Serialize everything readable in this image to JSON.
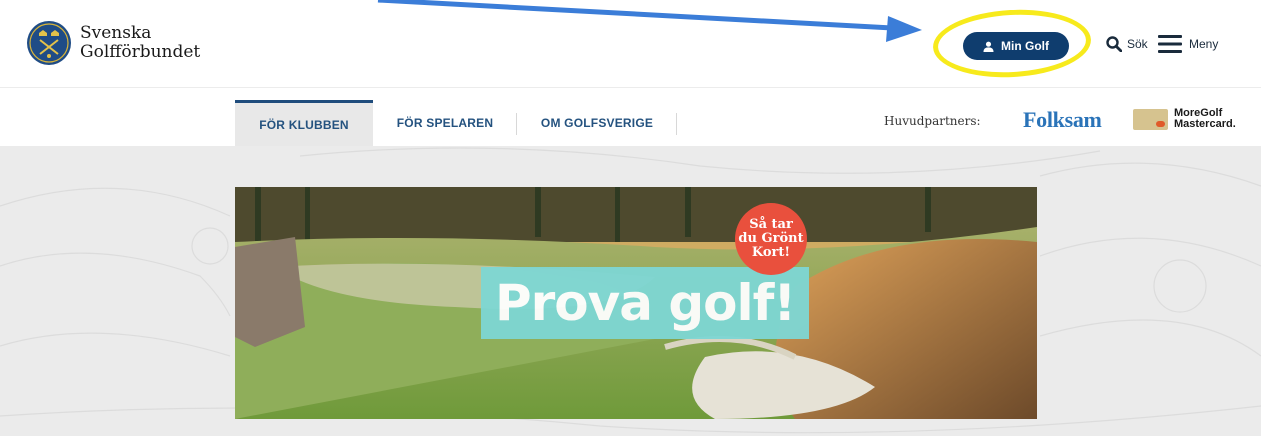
{
  "header": {
    "logo_line1": "Svenska",
    "logo_line2": "Golfförbundet",
    "min_golf_label": "Min Golf",
    "search_label": "Sök",
    "menu_label": "Meny"
  },
  "nav": {
    "tabs": [
      {
        "label": "FÖR KLUBBEN",
        "active": true
      },
      {
        "label": "FÖR SPELAREN",
        "active": false
      },
      {
        "label": "OM GOLFSVERIGE",
        "active": false
      }
    ],
    "partners_label": "Huvudpartners:",
    "partner1": "Folksam",
    "partner2_line1": "MoreGolf",
    "partner2_line2": "Mastercard."
  },
  "hero": {
    "title": "Prova golf!",
    "badge_line1": "Så tar",
    "badge_line2": "du Grönt",
    "badge_line3": "Kort!"
  },
  "colors": {
    "brand_navy": "#0f3d6e",
    "annotation_yellow": "#f7ea1c",
    "annotation_arrow": "#3b7dd8",
    "hero_title_bg": "#7ed7d4",
    "badge_red": "#e9503d"
  }
}
